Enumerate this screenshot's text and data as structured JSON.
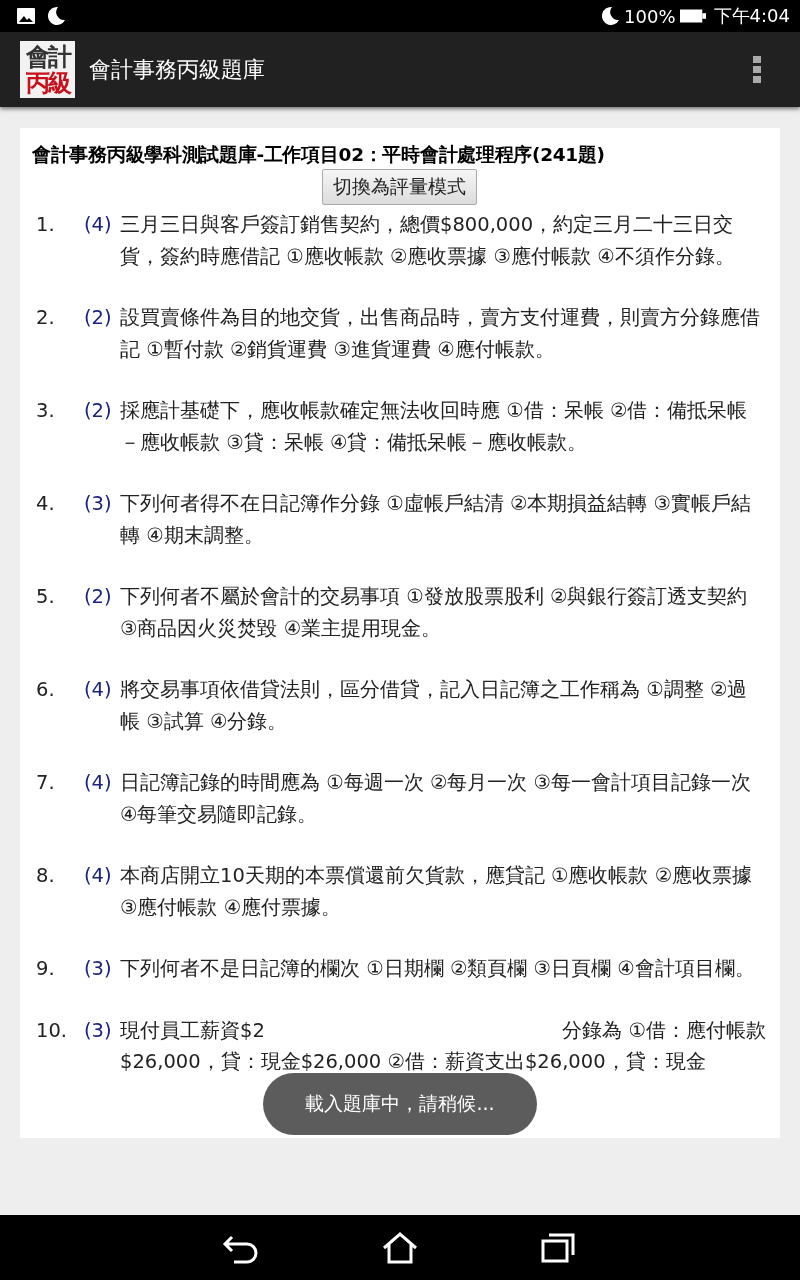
{
  "status_bar": {
    "battery": "100%",
    "time": "下午4:04"
  },
  "app_bar": {
    "title": "會計事務丙級題庫",
    "logo_top": "會計",
    "logo_bottom": "丙級"
  },
  "page": {
    "heading": "會計事務丙級學科測試題庫-工作項目02：平時會計處理程序(241題)",
    "mode_button": "切換為評量模式"
  },
  "questions": [
    {
      "number": "1.",
      "answer": "(4)",
      "text": "三月三日與客戶簽訂銷售契約，總價$800,000，約定三月二十三日交貨，簽約時應借記 ①應收帳款 ②應收票據 ③應付帳款 ④不須作分錄。"
    },
    {
      "number": "2.",
      "answer": "(2)",
      "text": "設買賣條件為目的地交貨，出售商品時，賣方支付運費，則賣方分錄應借記 ①暫付款 ②銷貨運費 ③進貨運費 ④應付帳款。"
    },
    {
      "number": "3.",
      "answer": "(2)",
      "text": "採應計基礎下，應收帳款確定無法收回時應 ①借：呆帳 ②借：備抵呆帳－應收帳款 ③貸：呆帳 ④貸：備抵呆帳－應收帳款。"
    },
    {
      "number": "4.",
      "answer": "(3)",
      "text": "下列何者得不在日記簿作分錄 ①虛帳戶結清 ②本期損益結轉 ③實帳戶結轉 ④期末調整。"
    },
    {
      "number": "5.",
      "answer": "(2)",
      "text": "下列何者不屬於會計的交易事項 ①發放股票股利 ②與銀行簽訂透支契約 ③商品因火災焚毀 ④業主提用現金。"
    },
    {
      "number": "6.",
      "answer": "(4)",
      "text": "將交易事項依借貸法則，區分借貸，記入日記簿之工作稱為 ①調整 ②過帳 ③試算 ④分錄。"
    },
    {
      "number": "7.",
      "answer": "(4)",
      "text": "日記簿記錄的時間應為 ①每週一次 ②每月一次 ③每一會計項目記錄一次 ④每筆交易隨即記錄。"
    },
    {
      "number": "8.",
      "answer": "(4)",
      "text": "本商店開立10天期的本票償還前欠貨款，應貸記 ①應收帳款 ②應收票據 ③應付帳款 ④應付票據。"
    },
    {
      "number": "9.",
      "answer": "(3)",
      "text": "下列何者不是日記簿的欄次 ①日期欄 ②類頁欄 ③日頁欄 ④會計項目欄。"
    }
  ],
  "last_question": {
    "number": "10.",
    "answer": "(3)",
    "text_before_toast": "現付員工薪資$2",
    "text_after_toast": "分錄為 ①借：應付帳款",
    "line_2": "$26,000，貸：現金$26,000 ②借：薪資支出$26,000，貸：現金"
  },
  "toast": "載入題庫中，請稍候..."
}
